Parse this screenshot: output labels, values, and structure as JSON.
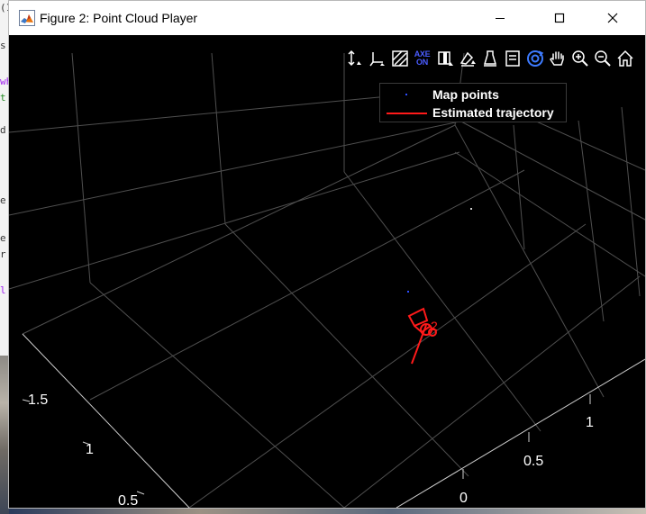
{
  "window": {
    "title": "Figure 2: Point Cloud Player"
  },
  "title_controls": {
    "minimize_icon": "minimize-icon",
    "maximize_icon": "maximize-icon",
    "close_icon": "close-icon"
  },
  "axes_toolbar": {
    "items": [
      {
        "name": "restrict-panning-icon"
      },
      {
        "name": "axes-display-icon"
      },
      {
        "name": "background-color-icon"
      },
      {
        "name": "axes-visibility-toggle",
        "text_top": "AXE",
        "text_bottom": "ON"
      },
      {
        "name": "view-plane-icon"
      },
      {
        "name": "color-source-icon"
      },
      {
        "name": "data-tips-icon"
      },
      {
        "name": "brush-icon"
      },
      {
        "name": "rotate-icon"
      },
      {
        "name": "pan-hand-icon"
      },
      {
        "name": "zoom-in-icon"
      },
      {
        "name": "zoom-out-icon"
      },
      {
        "name": "restore-view-home-icon"
      }
    ]
  },
  "legend": {
    "entries": [
      {
        "label": "Map points",
        "color": "#2c4dff",
        "marker": "point"
      },
      {
        "label": "Estimated trajectory",
        "color": "#ff1a1a",
        "marker": "line"
      }
    ]
  },
  "axes": {
    "left_ticks": [
      "1.5",
      "1",
      "0.5"
    ],
    "right_ticks": [
      "1",
      "0.5",
      "0"
    ]
  },
  "plot": {
    "background": "#000000",
    "grid_color": "#5a5a5a",
    "axis_color": "#cfcfcf",
    "trajectory_color": "#ff1a1a",
    "map_point_color": "#2c4dff",
    "camera_label": "2"
  },
  "background_text": {
    "lines": [
      "(1",
      "s",
      "wh",
      "t",
      "d",
      "e",
      "e",
      "r",
      "l"
    ]
  }
}
